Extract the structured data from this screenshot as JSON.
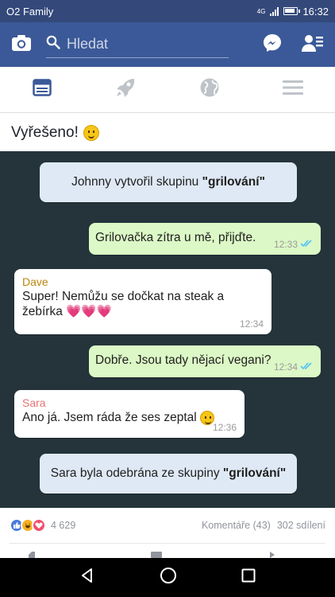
{
  "status_bar": {
    "carrier": "O2 Family",
    "network": "4G",
    "time": "16:32"
  },
  "header": {
    "search_placeholder": "Hledat"
  },
  "tabs": [
    {
      "icon": "news-feed-icon"
    },
    {
      "icon": "rocket-icon"
    },
    {
      "icon": "globe-icon"
    },
    {
      "icon": "menu-icon"
    }
  ],
  "post": {
    "caption": "Vyřešeno!"
  },
  "chat": {
    "system_created": {
      "prefix": "Johnny vytvořil skupinu ",
      "group": "\"grilování\""
    },
    "msg1": {
      "text": "Grilovačka zítra u mě, přijďte.",
      "time": "12:33"
    },
    "msg2": {
      "sender": "Dave",
      "text_line1": "Super! Nemůžu se dočkat na steak a",
      "text_line2": "žebírka 💗💗💗",
      "time": "12:34"
    },
    "msg3": {
      "text": "Dobře. Jsou tady nějací vegani?",
      "time": "12:34"
    },
    "msg4": {
      "sender": "Sara",
      "text": "Ano já. Jsem ráda že ses zeptal",
      "time": "12:36"
    },
    "system_removed": {
      "prefix": "Sara byla odebrána ze skupiny ",
      "group": "\"grilování\""
    }
  },
  "stats": {
    "reaction_count": "4 629",
    "comments": "Komentáře (43)",
    "shares": "302 sdílení"
  },
  "colors": {
    "facebook_blue": "#3b5998",
    "chat_bg": "#24343a",
    "outgoing": "#dcf8c6",
    "system": "#dfe9f5"
  }
}
